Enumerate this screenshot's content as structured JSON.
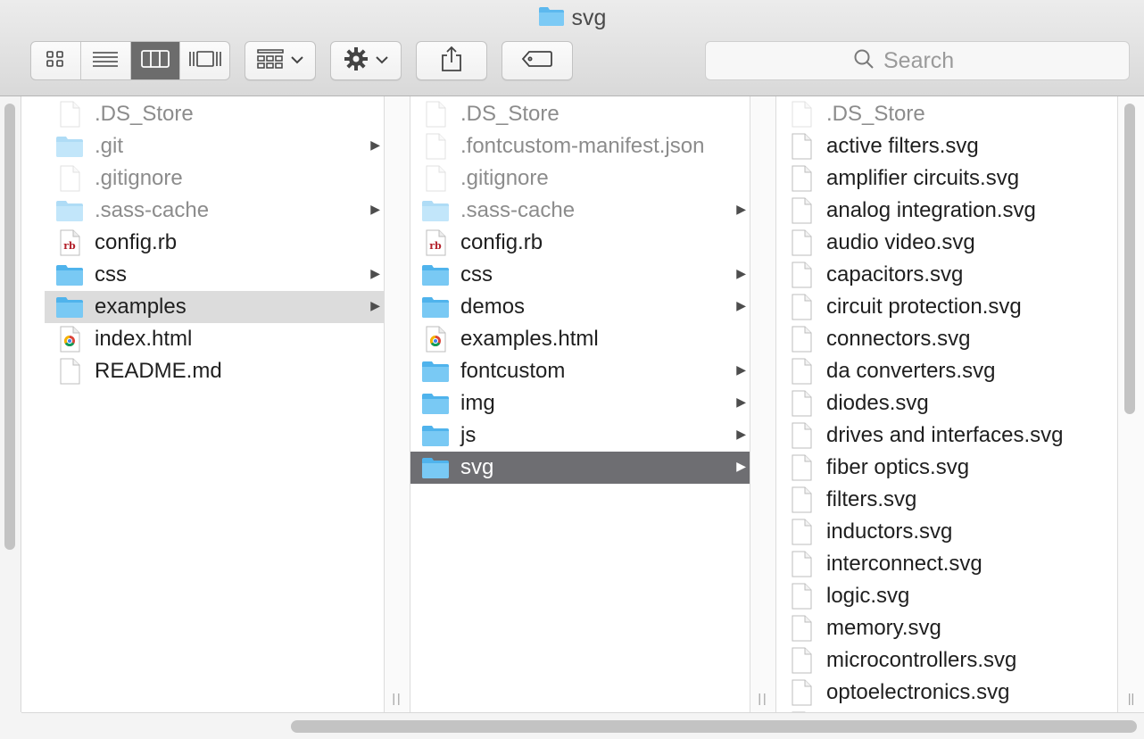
{
  "window": {
    "title": "svg"
  },
  "toolbar": {
    "view_modes": [
      {
        "name": "icon-view",
        "active": false
      },
      {
        "name": "list-view",
        "active": false
      },
      {
        "name": "column-view",
        "active": true
      },
      {
        "name": "cover-flow-view",
        "active": false
      }
    ],
    "arrange_icon": "grid-arrange-icon",
    "action_icon": "gear-icon",
    "share_icon": "share-icon",
    "tags_icon": "tag-icon",
    "search": {
      "placeholder": "Search",
      "value": ""
    }
  },
  "columns": [
    {
      "items": [
        {
          "label": ".DS_Store",
          "kind": "file",
          "dim": true,
          "arrow": false,
          "state": ""
        },
        {
          "label": ".git",
          "kind": "folder",
          "dim": true,
          "arrow": true,
          "state": ""
        },
        {
          "label": ".gitignore",
          "kind": "file",
          "dim": true,
          "arrow": false,
          "state": ""
        },
        {
          "label": ".sass-cache",
          "kind": "folder",
          "dim": true,
          "arrow": true,
          "state": ""
        },
        {
          "label": "config.rb",
          "kind": "ruby",
          "dim": false,
          "arrow": false,
          "state": ""
        },
        {
          "label": "css",
          "kind": "folder",
          "dim": false,
          "arrow": true,
          "state": ""
        },
        {
          "label": "examples",
          "kind": "folder",
          "dim": false,
          "arrow": true,
          "state": "selected-inactive"
        },
        {
          "label": "index.html",
          "kind": "html",
          "dim": false,
          "arrow": false,
          "state": ""
        },
        {
          "label": "README.md",
          "kind": "file",
          "dim": false,
          "arrow": false,
          "state": ""
        }
      ]
    },
    {
      "items": [
        {
          "label": ".DS_Store",
          "kind": "file",
          "dim": true,
          "arrow": false,
          "state": ""
        },
        {
          "label": ".fontcustom-manifest.json",
          "kind": "file",
          "dim": true,
          "arrow": false,
          "state": ""
        },
        {
          "label": ".gitignore",
          "kind": "file",
          "dim": true,
          "arrow": false,
          "state": ""
        },
        {
          "label": ".sass-cache",
          "kind": "folder",
          "dim": true,
          "arrow": true,
          "state": ""
        },
        {
          "label": "config.rb",
          "kind": "ruby",
          "dim": false,
          "arrow": false,
          "state": ""
        },
        {
          "label": "css",
          "kind": "folder",
          "dim": false,
          "arrow": true,
          "state": ""
        },
        {
          "label": "demos",
          "kind": "folder",
          "dim": false,
          "arrow": true,
          "state": ""
        },
        {
          "label": "examples.html",
          "kind": "html",
          "dim": false,
          "arrow": false,
          "state": ""
        },
        {
          "label": "fontcustom",
          "kind": "folder",
          "dim": false,
          "arrow": true,
          "state": ""
        },
        {
          "label": "img",
          "kind": "folder",
          "dim": false,
          "arrow": true,
          "state": ""
        },
        {
          "label": "js",
          "kind": "folder",
          "dim": false,
          "arrow": true,
          "state": ""
        },
        {
          "label": "svg",
          "kind": "folder",
          "dim": false,
          "arrow": true,
          "state": "selected"
        }
      ]
    },
    {
      "items": [
        {
          "label": ".DS_Store",
          "kind": "file",
          "dim": true,
          "arrow": false,
          "state": ""
        },
        {
          "label": "active filters.svg",
          "kind": "file",
          "dim": false,
          "arrow": false,
          "state": ""
        },
        {
          "label": "amplifier circuits.svg",
          "kind": "file",
          "dim": false,
          "arrow": false,
          "state": ""
        },
        {
          "label": "analog integration.svg",
          "kind": "file",
          "dim": false,
          "arrow": false,
          "state": ""
        },
        {
          "label": "audio video.svg",
          "kind": "file",
          "dim": false,
          "arrow": false,
          "state": ""
        },
        {
          "label": "capacitors.svg",
          "kind": "file",
          "dim": false,
          "arrow": false,
          "state": ""
        },
        {
          "label": "circuit protection.svg",
          "kind": "file",
          "dim": false,
          "arrow": false,
          "state": ""
        },
        {
          "label": "connectors.svg",
          "kind": "file",
          "dim": false,
          "arrow": false,
          "state": ""
        },
        {
          "label": "da converters.svg",
          "kind": "file",
          "dim": false,
          "arrow": false,
          "state": ""
        },
        {
          "label": "diodes.svg",
          "kind": "file",
          "dim": false,
          "arrow": false,
          "state": ""
        },
        {
          "label": "drives and interfaces.svg",
          "kind": "file",
          "dim": false,
          "arrow": false,
          "state": ""
        },
        {
          "label": "fiber optics.svg",
          "kind": "file",
          "dim": false,
          "arrow": false,
          "state": ""
        },
        {
          "label": "filters.svg",
          "kind": "file",
          "dim": false,
          "arrow": false,
          "state": ""
        },
        {
          "label": "inductors.svg",
          "kind": "file",
          "dim": false,
          "arrow": false,
          "state": ""
        },
        {
          "label": "interconnect.svg",
          "kind": "file",
          "dim": false,
          "arrow": false,
          "state": ""
        },
        {
          "label": "logic.svg",
          "kind": "file",
          "dim": false,
          "arrow": false,
          "state": ""
        },
        {
          "label": "memory.svg",
          "kind": "file",
          "dim": false,
          "arrow": false,
          "state": ""
        },
        {
          "label": "microcontrollers.svg",
          "kind": "file",
          "dim": false,
          "arrow": false,
          "state": ""
        },
        {
          "label": "optoelectronics.svg",
          "kind": "file",
          "dim": false,
          "arrow": false,
          "state": ""
        },
        {
          "label": "",
          "kind": "file",
          "dim": false,
          "arrow": false,
          "state": ""
        }
      ]
    }
  ],
  "colors": {
    "selection": "#6e6e72",
    "inactive_selection": "#dcdcdc",
    "folder": "#6cc3f2"
  }
}
